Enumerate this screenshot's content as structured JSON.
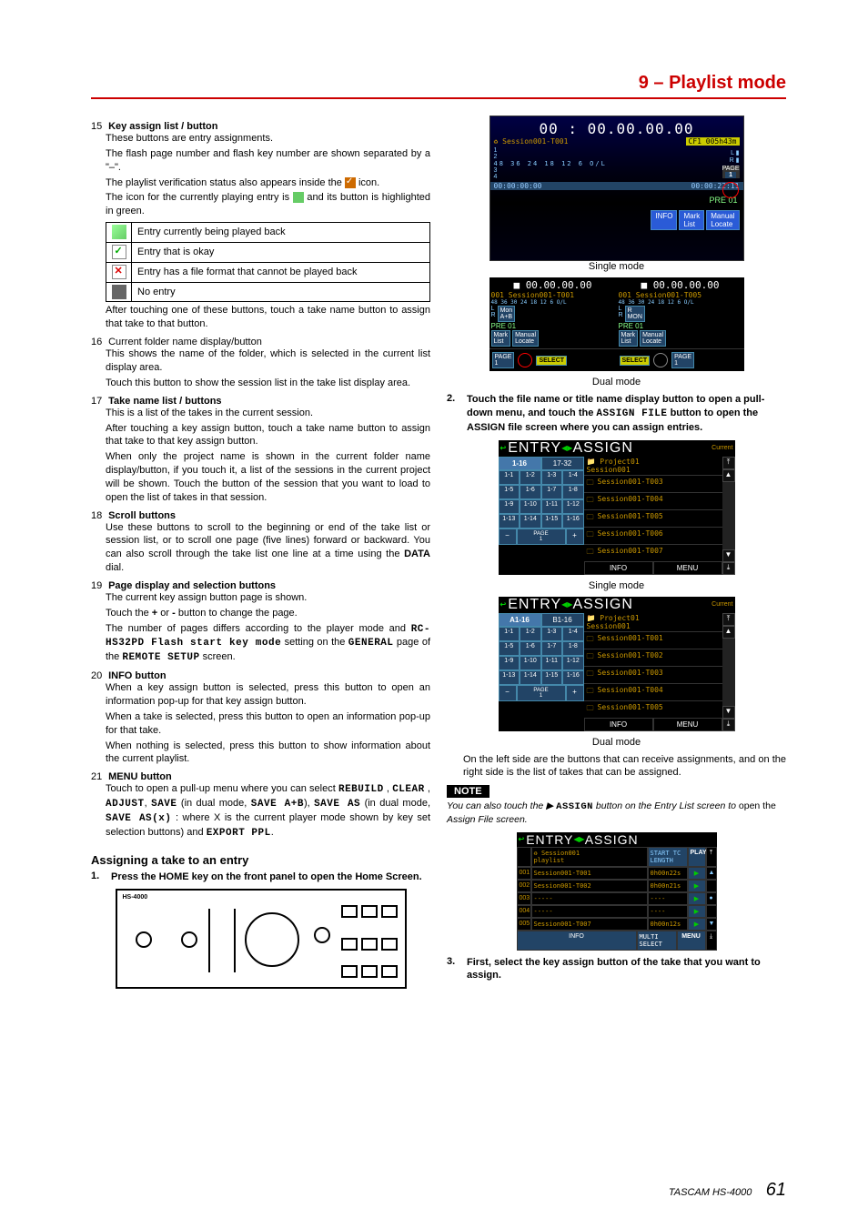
{
  "chapter": "9 – Playlist mode",
  "items": [
    {
      "n": "15",
      "title": "Key assign list / button",
      "paras": [
        "These buttons are entry assignments.",
        "The flash page number and flash key number are shown separated by a \"–\".",
        "The playlist verification status also appears inside the __CHKICON__ icon.",
        "The icon for the currently playing entry is __PLAYICON__ and its button is highlighted in green."
      ],
      "table": [
        [
          "play",
          "Entry currently being played back"
        ],
        [
          "ok",
          "Entry that is okay"
        ],
        [
          "bad",
          "Entry has a file format that cannot be played back"
        ],
        [
          "empty",
          "No entry"
        ]
      ],
      "after": "After touching one of these buttons, touch a take name button to assign that take to that button."
    },
    {
      "n": "16",
      "title": "Current folder name display/button",
      "plain": true,
      "paras": [
        "This shows the name of the folder, which is selected in the current list display area.",
        "Touch this button to show the session list in the take list display area."
      ]
    },
    {
      "n": "17",
      "title": "Take name list / buttons",
      "paras": [
        "This is a list of the takes in the current session.",
        "After touching a key assign button, touch a take name button to assign that take to that key assign button.",
        "When only the project name is shown in the current folder name display/button, if you touch it, a list of the sessions in the current project will be shown. Touch the button of the session that you want to load to open the list of takes in that session."
      ]
    },
    {
      "n": "18",
      "title": "Scroll buttons",
      "paras": [
        "Use these buttons to scroll to the beginning or end of the take list or session list, or to scroll one page (five lines) forward or backward. You can also scroll through the take list one line at a time using the <b>DATA</b> dial."
      ]
    },
    {
      "n": "19",
      "title": "Page display and selection buttons",
      "paras": [
        "The current key assign button page is shown.",
        "Touch the <b>+</b> or <b>-</b> button to change the page.",
        "The number of pages differs according to the player mode and <span class='ospace'>RC-HS32PD Flash start key mode</span> setting on the <span class='ospace'>GENERAL</span> page of the <span class='ospace'>REMOTE SETUP</span> screen."
      ]
    },
    {
      "n": "20",
      "title": "INFO button",
      "paras": [
        "When a key assign button is selected, press this button to open an information pop-up for that key assign button.",
        "When a take is selected, press this button to open an information pop-up for that take.",
        "When nothing is selected, press this button to show information about the current playlist."
      ]
    },
    {
      "n": "21",
      "title": "MENU button",
      "paras": [
        "Touch to open a pull-up menu where you can select <span class='ospace'>REBUILD</span> , <span class='ospace'>CLEAR</span> , <span class='ospace'>ADJUST</span>, <span class='ospace'>SAVE</span> (in dual mode, <span class='ospace'>SAVE A+B</span>), <span class='ospace'>SAVE AS</span> (in dual mode, <span class='ospace'>SAVE AS(x)</span> : where X is the current player mode shown by key set selection buttons) and <span class='ospace'>EXPORT PPL</span>."
      ]
    }
  ],
  "section": "Assigning a take to an entry",
  "step1": {
    "n": "1.",
    "t": "Press the HOME key on the front panel to open the Home Screen."
  },
  "hw_label": "HS-4000",
  "single_tc": "00 : 00.00.00.00",
  "single_row": "Session001-T001",
  "single_cf": "CF1 005h43m",
  "single_meter_nums": "48 36 24 18 12 6 O/L",
  "single_tc_small_l": "00:00:00:00",
  "single_tc_small_r": "00:00:22:11",
  "single_pre": "PRE 01",
  "single_info": "INFO",
  "single_mark": "Mark\nList",
  "single_manual": "Manual\nLocate",
  "cap_single": "Single mode",
  "dual_tc_a": "00.00.00.00",
  "dual_tc_b": "00.00.00.00",
  "dual_sess_a": "001 Session001-T001",
  "dual_sess_b": "001 Session001-T005",
  "dual_meter": "48 36 30 24 18 12 6 O/L",
  "dual_mon": "Mon\nA+B",
  "dual_rmon": "R\nMON",
  "dual_pre": "PRE 01",
  "dual_mark": "Mark\nList",
  "dual_manual": "Manual\nLocate",
  "dual_page": "PAGE\n1",
  "dual_select": "SELECT",
  "cap_dual": "Dual mode",
  "step2_prefix": "2.",
  "step2": "Touch the file name or title name display button to open a pull-down menu, and touch the __ASSIGN_FILE__ button to open the ASSIGN file screen where you can assign entries.",
  "assign_file_token": "ASSIGN FILE",
  "assign_title_arrow1": "↩",
  "assign_title_entry": "ENTRY",
  "assign_title_assign": "ASSIGN",
  "assign_current": "Current",
  "assign_single_tabs": [
    "1-16",
    "17-32"
  ],
  "assign_single_proj": "Project01\nSession001",
  "assign_single_grid": [
    "1-1",
    "1-2",
    "1-3",
    "1-4",
    "1-5",
    "1-6",
    "1-7",
    "1-8",
    "1-9",
    "1-10",
    "1-11",
    "1-12",
    "1-13",
    "1-14",
    "1-15",
    "1-16"
  ],
  "assign_single_files": [
    "Session001-T003",
    "Session001-T004",
    "Session001-T005",
    "Session001-T006",
    "Session001-T007"
  ],
  "assign_page_minus": "−",
  "assign_page_lbl": "PAGE\n1",
  "assign_page_plus": "+",
  "assign_info": "INFO",
  "assign_menu": "MENU",
  "cap_single2": "Single mode",
  "assign_dual_tabs": [
    "A1-16",
    "B1-16"
  ],
  "assign_dual_proj": "Project01\nSession001",
  "assign_dual_files": [
    "Session001-T001",
    "Session001-T002",
    "Session001-T003",
    "Session001-T004",
    "Session001-T005"
  ],
  "cap_dual2": "Dual mode",
  "after_dual": "On the left side are the buttons that can receive assignments, and on the right side is the list of takes that can be assigned.",
  "note_label": "NOTE",
  "note_body": "You can also touch the ▶ __ASSIGNBTN__ button on the Entry List screen to open the Assign File screen.",
  "note_assign_token": "ASSIGN",
  "ea_sess": "Session001\nplaylist",
  "ea_hdr_len": "START TC\nLENGTH",
  "ea_play": "PLAY",
  "ea_rows": [
    {
      "n": "001",
      "f": "Session001-T001",
      "len": "0h00n22s"
    },
    {
      "n": "002",
      "f": "Session001-T002",
      "len": "0h00n21s"
    },
    {
      "n": "003",
      "f": "-----",
      "len": "----"
    },
    {
      "n": "004",
      "f": "-----",
      "len": "----"
    },
    {
      "n": "005",
      "f": "Session001-T007",
      "len": "0h00n12s"
    }
  ],
  "ea_info": "INFO",
  "ea_multi": "MULTI\nSELECT",
  "ea_menu": "MENU",
  "step3": {
    "n": "3.",
    "t": "First, select the key assign button of the take that you want to assign."
  },
  "footer_model": "TASCAM  HS-4000",
  "footer_page": "61"
}
